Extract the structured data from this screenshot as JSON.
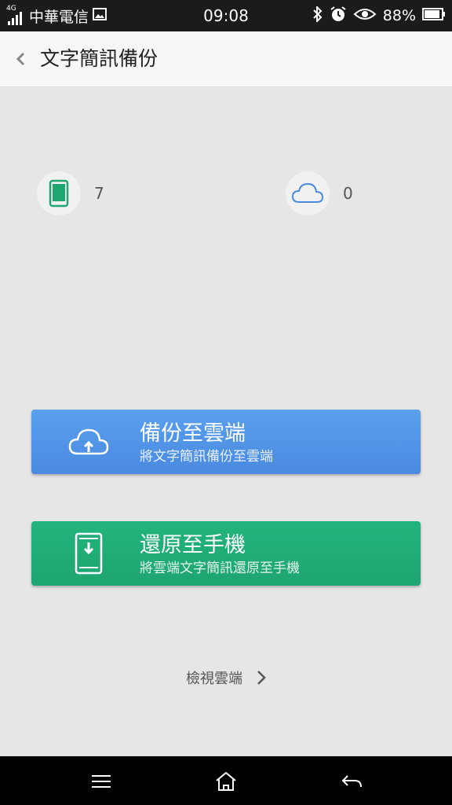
{
  "status_bar": {
    "network_type": "4G",
    "carrier": "中華電信",
    "time": "09:08",
    "battery": "88%"
  },
  "header": {
    "title": "文字簡訊備份"
  },
  "counts": {
    "phone_count": "7",
    "cloud_count": "0"
  },
  "backup_button": {
    "title": "備份至雲端",
    "subtitle": "將文字簡訊備份至雲端"
  },
  "restore_button": {
    "title": "還原至手機",
    "subtitle": "將雲端文字簡訊還原至手機"
  },
  "view_cloud_link": {
    "label": "檢視雲端"
  },
  "colors": {
    "backup_blue": "#4a8ae0",
    "restore_green": "#1ea570",
    "phone_icon_green": "#1ea570",
    "cloud_icon_blue": "#4a8ae0"
  },
  "icons": [
    "signal-icon",
    "image-icon",
    "bluetooth-icon",
    "alarm-icon",
    "eye-icon",
    "battery-icon",
    "phone-icon",
    "cloud-icon",
    "cloud-upload-icon",
    "phone-download-icon",
    "chevron-right-icon",
    "menu-icon",
    "home-icon",
    "back-arrow-icon"
  ]
}
